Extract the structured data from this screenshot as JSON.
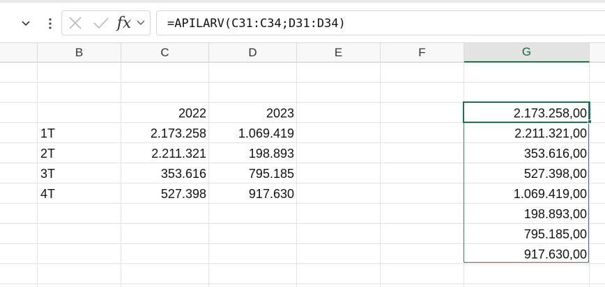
{
  "formula_bar": {
    "namebox_dropdown_icon": "chevron-down",
    "more_icon": "vertical-ellipsis",
    "cancel_icon": "x-mark",
    "enter_icon": "check-mark",
    "fx_label": "fx",
    "fx_dropdown_icon": "chevron-down",
    "formula": "=APILARV(C31:C34;D31:D34)"
  },
  "columns": [
    "B",
    "C",
    "D",
    "E",
    "F",
    "G"
  ],
  "selected_column": "G",
  "cells": {
    "c_year": "2022",
    "d_year": "2023",
    "rows": [
      {
        "label": "1T",
        "c": "2.173.258",
        "d": "1.069.419"
      },
      {
        "label": "2T",
        "c": "2.211.321",
        "d": "198.893"
      },
      {
        "label": "3T",
        "c": "353.616",
        "d": "795.185"
      },
      {
        "label": "4T",
        "c": "527.398",
        "d": "917.630"
      }
    ],
    "g": [
      "2.173.258,00",
      "2.211.321,00",
      "353.616,00",
      "527.398,00",
      "1.069.419,00",
      "198.893,00",
      "795.185,00",
      "917.630,00"
    ]
  },
  "colors": {
    "selection": "#1e7145",
    "spill": "#3a6fb7"
  }
}
